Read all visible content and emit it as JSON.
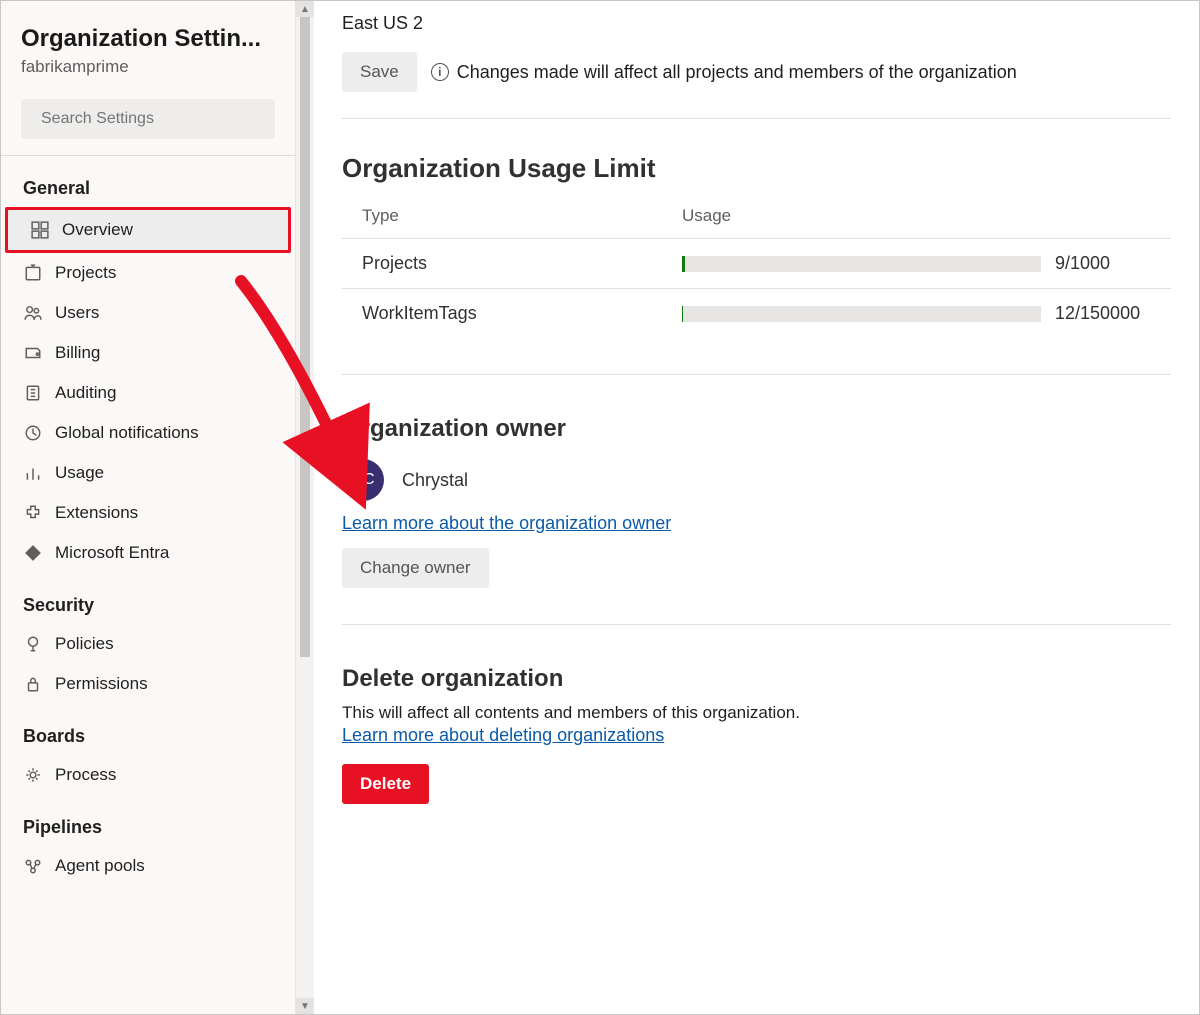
{
  "sidebar": {
    "title": "Organization Settin...",
    "subtitle": "fabrikamprime",
    "search_placeholder": "Search Settings",
    "groups": [
      {
        "label": "General",
        "items": [
          {
            "key": "overview",
            "label": "Overview",
            "selected": true,
            "highlighted": true
          },
          {
            "key": "projects",
            "label": "Projects"
          },
          {
            "key": "users",
            "label": "Users"
          },
          {
            "key": "billing",
            "label": "Billing"
          },
          {
            "key": "auditing",
            "label": "Auditing"
          },
          {
            "key": "global-notifications",
            "label": "Global notifications"
          },
          {
            "key": "usage",
            "label": "Usage"
          },
          {
            "key": "extensions",
            "label": "Extensions"
          },
          {
            "key": "microsoft-entra",
            "label": "Microsoft Entra"
          }
        ]
      },
      {
        "label": "Security",
        "items": [
          {
            "key": "policies",
            "label": "Policies"
          },
          {
            "key": "permissions",
            "label": "Permissions"
          }
        ]
      },
      {
        "label": "Boards",
        "items": [
          {
            "key": "process",
            "label": "Process"
          }
        ]
      },
      {
        "label": "Pipelines",
        "items": [
          {
            "key": "agent-pools",
            "label": "Agent pools"
          }
        ]
      }
    ]
  },
  "main": {
    "region": "East US 2",
    "save_label": "Save",
    "info_text": "Changes made will affect all projects and members of the organization",
    "usage_limit": {
      "heading": "Organization Usage Limit",
      "col_type": "Type",
      "col_usage": "Usage",
      "rows": [
        {
          "type": "Projects",
          "value": 9,
          "max": 1000,
          "display": "9/1000"
        },
        {
          "type": "WorkItemTags",
          "value": 12,
          "max": 150000,
          "display": "12/150000"
        }
      ]
    },
    "owner": {
      "heading": "Organization owner",
      "avatar_initials": "CC",
      "name": "Chrystal",
      "learn_more": "Learn more about the organization owner",
      "change_label": "Change owner"
    },
    "delete": {
      "heading": "Delete organization",
      "text": "This will affect all contents and members of this organization.",
      "learn_more": "Learn more about deleting organizations",
      "button": "Delete"
    }
  }
}
